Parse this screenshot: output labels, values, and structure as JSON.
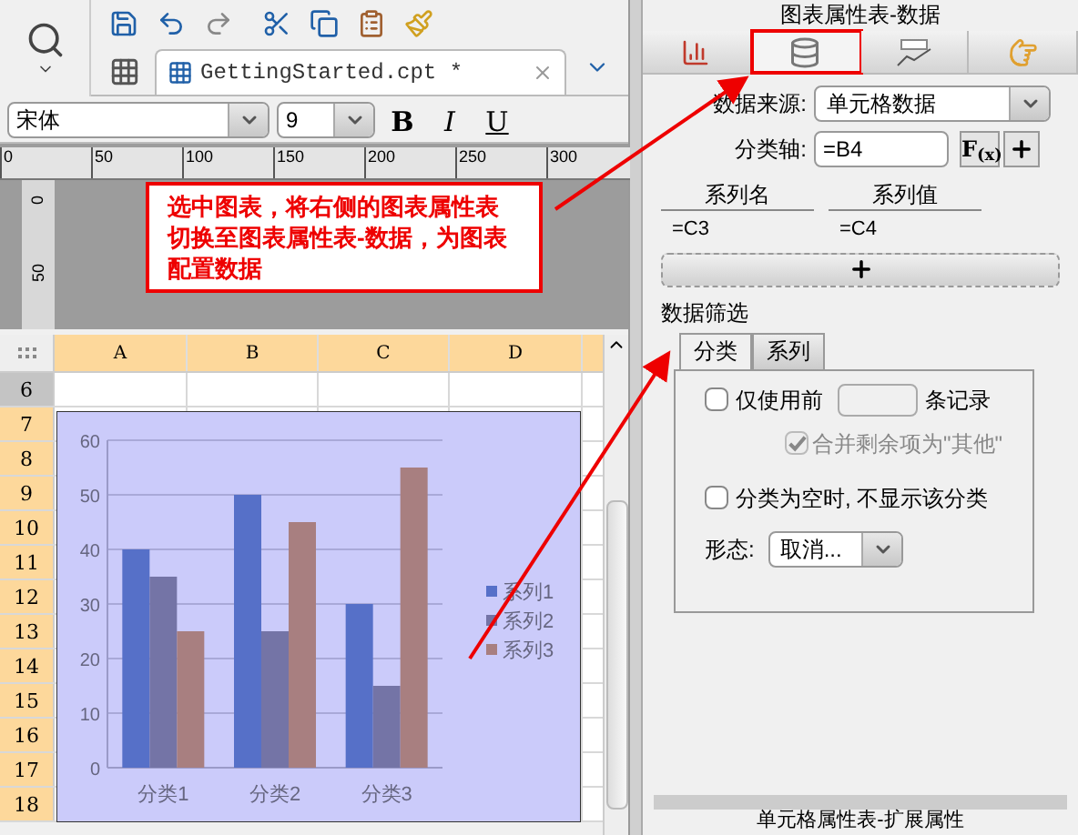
{
  "toolbar": {
    "file_tab": {
      "label": "GettingStarted.cpt *",
      "selected": true
    },
    "font_name": "宋体",
    "font_size": "9",
    "style_buttons": [
      {
        "label": "B",
        "kind": "bold"
      },
      {
        "label": "I",
        "kind": "italic"
      },
      {
        "label": "U",
        "kind": "underline"
      }
    ]
  },
  "ruler": {
    "ticks": [
      "0",
      "50",
      "100",
      "150",
      "200",
      "250",
      "300"
    ],
    "vertical_ticks": [
      "0",
      "50"
    ]
  },
  "callout": "选中图表，将右侧的图表属性表切换至图表属性表-数据，为图表配置数据",
  "sheet": {
    "columns": [
      "A",
      "B",
      "C",
      "D"
    ],
    "rows": [
      {
        "label": "6",
        "selected": false
      },
      {
        "label": "7",
        "selected": true
      },
      {
        "label": "8",
        "selected": true
      },
      {
        "label": "9",
        "selected": true
      },
      {
        "label": "10",
        "selected": true
      },
      {
        "label": "11",
        "selected": true
      },
      {
        "label": "12",
        "selected": true
      },
      {
        "label": "13",
        "selected": true
      },
      {
        "label": "14",
        "selected": true
      },
      {
        "label": "15",
        "selected": true
      },
      {
        "label": "16",
        "selected": true
      },
      {
        "label": "17",
        "selected": true
      },
      {
        "label": "18",
        "selected": true
      }
    ]
  },
  "chart": {
    "chart_data": {
      "type": "bar",
      "categories": [
        "分类1",
        "分类2",
        "分类3"
      ],
      "series": [
        {
          "name": "系列1",
          "color": "#5670c8",
          "values": [
            40,
            50,
            30
          ]
        },
        {
          "name": "系列2",
          "color": "#7474a6",
          "values": [
            35,
            25,
            15
          ]
        },
        {
          "name": "系列3",
          "color": "#a87f80",
          "values": [
            25,
            45,
            55
          ]
        }
      ],
      "ylim": [
        0,
        60
      ],
      "yticks": [
        {
          "value": 0,
          "label": "0"
        },
        {
          "value": 10,
          "label": "10"
        },
        {
          "value": 20,
          "label": "20"
        },
        {
          "value": 30,
          "label": "30"
        },
        {
          "value": 40,
          "label": "40"
        },
        {
          "value": 50,
          "label": "50"
        },
        {
          "value": 60,
          "label": "60"
        }
      ],
      "grid": true,
      "legend": true
    }
  },
  "panel": {
    "title": "图表属性表-数据",
    "tabs": [
      {
        "kind": "chart",
        "selected": false
      },
      {
        "kind": "data",
        "selected": true
      },
      {
        "kind": "text",
        "selected": false
      },
      {
        "kind": "hand",
        "selected": false
      }
    ],
    "source_label": "数据来源:",
    "source_value": "单元格数据",
    "axis_label": "分类轴:",
    "axis_value": "=B4",
    "formula_button": "F$_{(x)}$",
    "series_columns": [
      "系列名",
      "系列值"
    ],
    "series_rows": [
      [
        "=C3",
        "=C4"
      ]
    ],
    "filter_title": "数据筛选",
    "filter_tabs": [
      {
        "label": "分类",
        "selected": true
      },
      {
        "label": "系列",
        "selected": false
      }
    ],
    "use_first": {
      "checked": false,
      "label_before": "仅使用前",
      "label_after": "条记录"
    },
    "merge_rest": {
      "checked": true,
      "disabled": true,
      "label": "合并剩余项为\"其他\""
    },
    "hide_empty": {
      "checked": false,
      "label": "分类为空时, 不显示该分类"
    },
    "form_label": "形态:",
    "form_value": "取消...",
    "bottom_title": "单元格属性表-扩展属性"
  }
}
